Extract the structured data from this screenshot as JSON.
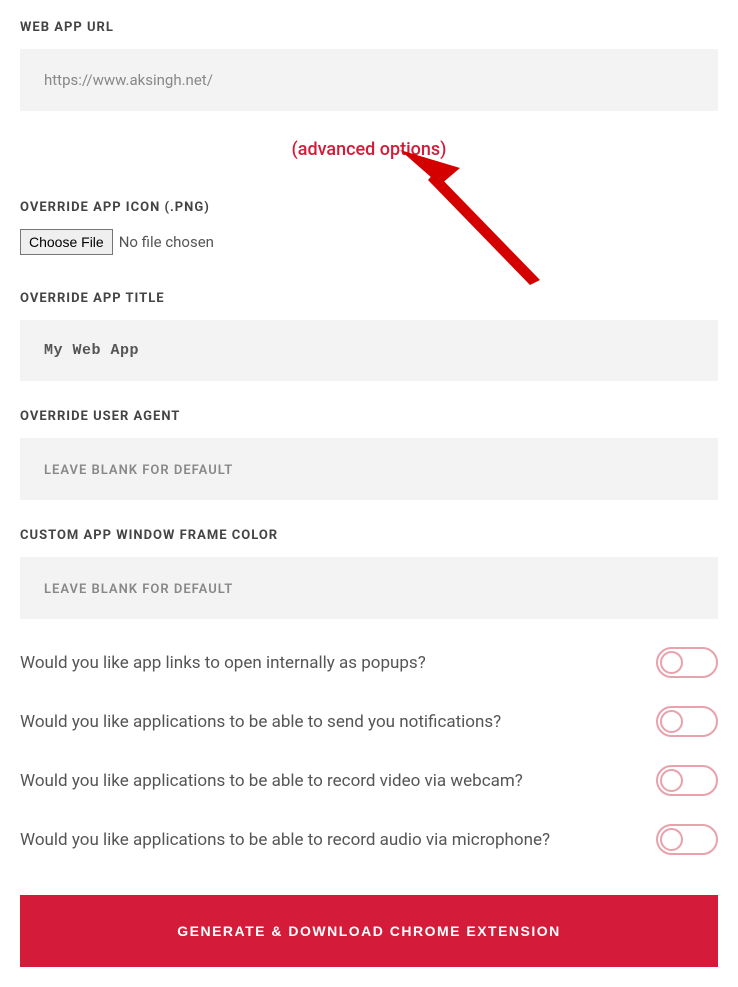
{
  "labels": {
    "web_app_url": "Web App URL",
    "advanced_options": "(advanced options)",
    "override_icon": "Override App Icon (.PNG)",
    "choose_file": "Choose File",
    "no_file": "No file chosen",
    "override_title": "Override App Title",
    "override_user_agent": "Override User Agent",
    "frame_color": "Custom App Window Frame Color",
    "generate": "Generate & Download Chrome Extension"
  },
  "inputs": {
    "url_value": "https://www.aksingh.net/",
    "title_value": "My Web App",
    "user_agent_placeholder": "Leave blank for default",
    "frame_color_placeholder": "Leave blank for default"
  },
  "toggles": {
    "popups": "Would you like app links to open internally as popups?",
    "notifications": "Would you like applications to be able to send you notifications?",
    "video": "Would you like applications to be able to record video via webcam?",
    "audio": "Would you like applications to be able to record audio via microphone?"
  }
}
